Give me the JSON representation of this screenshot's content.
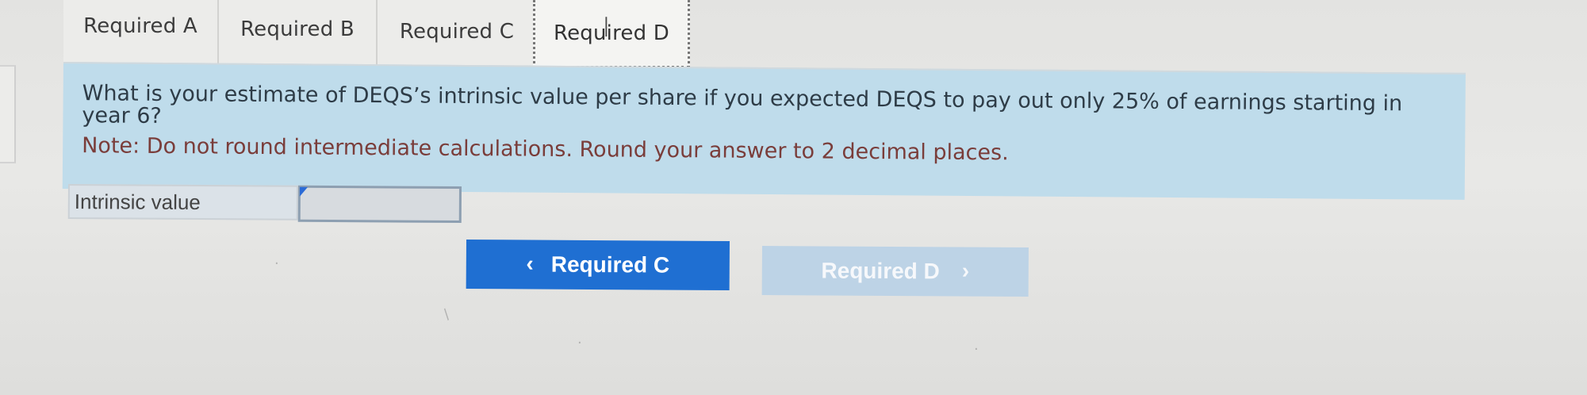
{
  "tabs": [
    {
      "label": "Required A"
    },
    {
      "label": "Required B"
    },
    {
      "label": "Required C"
    },
    {
      "label": "Required D"
    }
  ],
  "question": {
    "text": "What is your estimate of DEQS’s intrinsic value per share if you expected DEQS to pay out only 25% of earnings starting in year 6?",
    "note": "Note: Do not round intermediate calculations. Round your answer to 2 decimal places."
  },
  "answer": {
    "label": "Intrinsic value",
    "value": ""
  },
  "navigation": {
    "previous": "Required C",
    "next": "Required D"
  },
  "colors": {
    "panel": "#bfdceb",
    "primary_button": "#1f6fd2",
    "disabled_button": "#bdd3e6",
    "note": "#7a3d3a"
  }
}
